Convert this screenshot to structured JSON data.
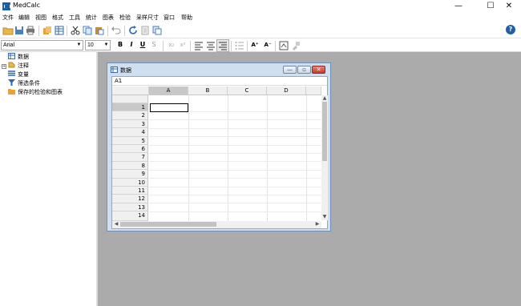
{
  "app": {
    "title": "MedCalc"
  },
  "window_controls": {
    "minimize": "—",
    "maximize": "☐",
    "close": "✕"
  },
  "menu": [
    "文件",
    "编辑",
    "视图",
    "格式",
    "工具",
    "统计",
    "图表",
    "检验",
    "采样尺寸",
    "窗口",
    "帮助"
  ],
  "toolbar": {
    "icons": [
      "open-folder-icon",
      "save-icon",
      "print-icon",
      "copy-doc-icon",
      "spreadsheet-icon",
      "cut-icon",
      "copy-icon",
      "paste-icon",
      "undo-icon",
      "refresh-icon",
      "report-icon",
      "page-icon"
    ],
    "help_icon": "?"
  },
  "format_bar": {
    "font": "Arial",
    "size": "10",
    "bold": "B",
    "italic": "I",
    "underline": "U",
    "strike": "S",
    "subscript": "x₂",
    "superscript": "x²",
    "font_grow": "A⁺",
    "font_shrink": "A⁻"
  },
  "tree": [
    {
      "label": "数据",
      "icon": "spreadsheet-icon"
    },
    {
      "label": "注释",
      "icon": "notes-icon",
      "expander": "+"
    },
    {
      "label": "变量",
      "icon": "variables-icon"
    },
    {
      "label": "筛选条件",
      "icon": "filter-icon"
    },
    {
      "label": "保存的检验和图表",
      "icon": "folder-icon"
    }
  ],
  "data_window": {
    "title": "数据",
    "cell_ref": "A1",
    "columns": [
      "A",
      "B",
      "C",
      "D"
    ],
    "rows": [
      "1",
      "2",
      "3",
      "4",
      "5",
      "6",
      "7",
      "8",
      "9",
      "10",
      "11",
      "12",
      "13",
      "14"
    ]
  },
  "scroll": {
    "up": "▲",
    "down": "▼",
    "left": "◀",
    "right": "▶"
  },
  "colors": {
    "accent": "#1f5fa8",
    "workspace": "#ababab",
    "mdi_frame": "#cfdff0"
  }
}
